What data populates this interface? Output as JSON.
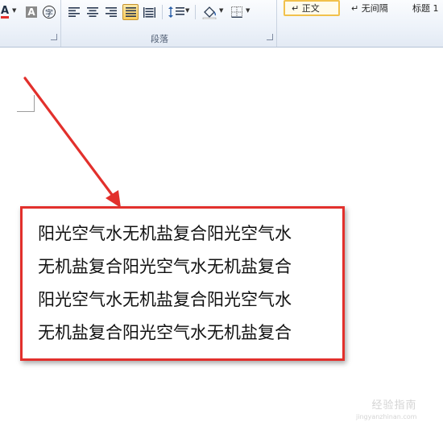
{
  "ribbon": {
    "font_color_glyph": "A",
    "char_shading_glyph": "A",
    "enclose_char_glyph": "字",
    "paragraph_group_label": "段落",
    "styles": [
      {
        "label": "↵ 正文",
        "selected": true
      },
      {
        "label": "↵ 无间隔",
        "selected": false
      },
      {
        "label": "标题 1",
        "selected": false
      }
    ]
  },
  "document": {
    "lines": [
      "阳光空气水无机盐复合阳光空气水",
      "无机盐复合阳光空气水无机盐复合",
      "阳光空气水无机盐复合阳光空气水",
      "无机盐复合阳光空气水无机盐复合"
    ]
  },
  "annotation": {
    "arrow_color": "#e2302c",
    "box_color": "#e2302c"
  },
  "watermark": {
    "text": "经验指南",
    "url": "jingyanzhinan.com"
  }
}
